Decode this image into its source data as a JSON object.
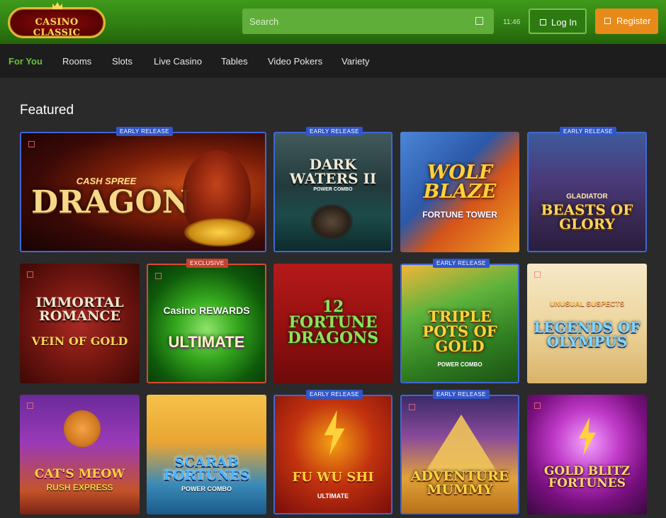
{
  "header": {
    "logo_text": "CASINO CLASSIC",
    "search_placeholder": "Search",
    "clock": "11:46",
    "login_label": "Log In",
    "register_label": "Register"
  },
  "nav": {
    "items": [
      "For You",
      "Rooms",
      "Slots",
      "Live Casino",
      "Tables",
      "Video Pokers",
      "Variety"
    ],
    "active": "For You"
  },
  "section_title": "Featured",
  "badges": {
    "early": "EARLY RELEASE",
    "exclusive": "EXCLUSIVE"
  },
  "games": [
    {
      "title": "DRAGON",
      "sub": "CASH SPREE",
      "badge": "EARLY RELEASE"
    },
    {
      "title": "DARK WATERS II",
      "sub": "POWER COMBO",
      "badge": "EARLY RELEASE"
    },
    {
      "title": "WOLF BLAZE",
      "sub": "FORTUNE TOWER"
    },
    {
      "title": "BEASTS OF GLORY",
      "sub": "GLADIATOR",
      "badge": "EARLY RELEASE"
    },
    {
      "title": "IMMORTAL ROMANCE",
      "sub": "VEIN OF GOLD"
    },
    {
      "title": "ULTIMATE",
      "sub": "Casino REWARDS",
      "badge": "EXCLUSIVE"
    },
    {
      "title": "12 FORTUNE DRAGONS",
      "sub": ""
    },
    {
      "title": "TRIPLE POTS OF GOLD",
      "sub": "POWER COMBO",
      "badge": "EARLY RELEASE"
    },
    {
      "title": "LEGENDS OF OLYMPUS",
      "sub": "UNUSUAL SUSPECTS"
    },
    {
      "title": "CAT'S MEOW",
      "sub": "RUSH EXPRESS"
    },
    {
      "title": "SCARAB FORTUNES",
      "sub": "POWER COMBO"
    },
    {
      "title": "FU WU SHI",
      "sub": "ULTIMATE",
      "badge": "EARLY RELEASE"
    },
    {
      "title": "ADVENTURE MUMMY",
      "sub": "",
      "badge": "EARLY RELEASE"
    },
    {
      "title": "GOLD BLITZ FORTUNES",
      "sub": ""
    }
  ],
  "colors": {
    "header_green": "#2f7d12",
    "accent_green": "#6cc23b",
    "register_orange": "#e88a1a",
    "badge_blue": "#3056c8",
    "badge_red": "#c7412c"
  }
}
